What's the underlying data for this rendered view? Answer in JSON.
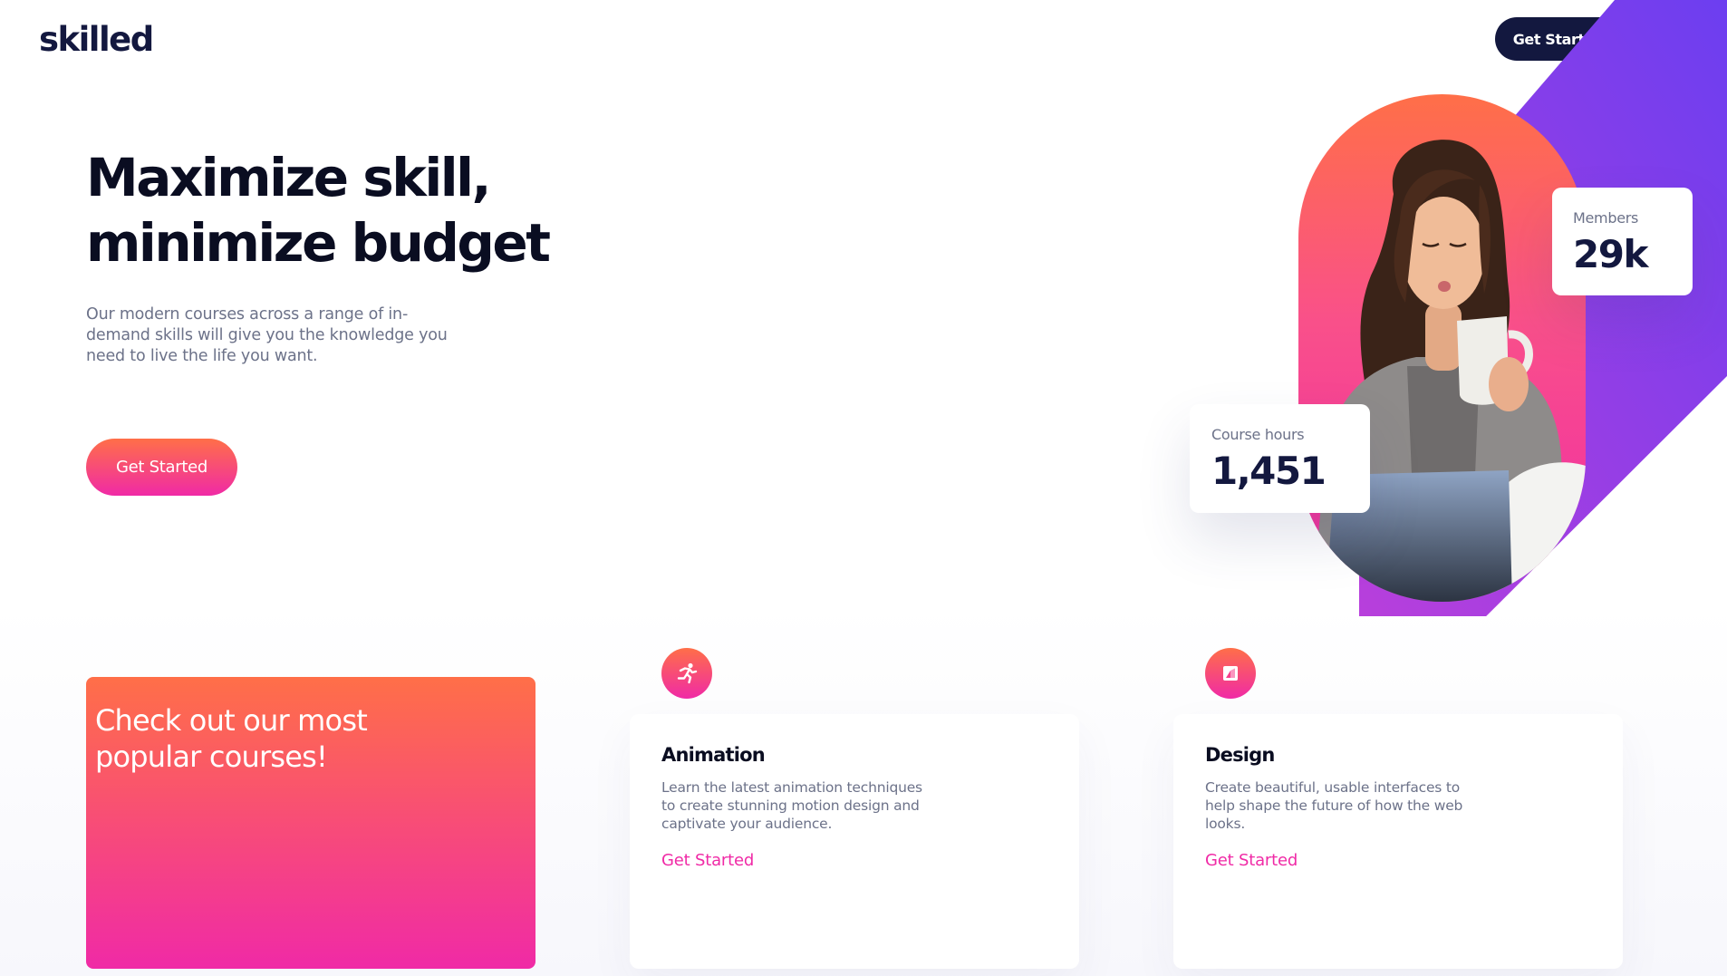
{
  "header": {
    "logo": "skilled",
    "cta_label": "Get Started"
  },
  "hero": {
    "title_line1": "Maximize skill,",
    "title_line2": "minimize budget",
    "description": "Our modern courses across a range of in-demand skills will give you the knowledge you need to live the life you want.",
    "cta_label": "Get Started"
  },
  "stats": {
    "members": {
      "label": "Members",
      "value": "29k"
    },
    "course_hours": {
      "label": "Course hours",
      "value": "1,451"
    }
  },
  "courses": {
    "promo_title": "Check out our most popular courses!",
    "items": [
      {
        "icon": "animation-icon",
        "title": "Animation",
        "description": "Learn the latest animation techniques to create stunning motion design and captivate your audience.",
        "link_label": "Get Started"
      },
      {
        "icon": "design-icon",
        "title": "Design",
        "description": "Create beautiful, usable interfaces to help shape the future of how the web looks.",
        "link_label": "Get Started"
      }
    ]
  },
  "colors": {
    "navy": "#13183f",
    "gradient_start": "#ff6f48",
    "gradient_end": "#f02aa6",
    "purple_band": "#8b3fe6",
    "text_muted": "#6c7289"
  }
}
